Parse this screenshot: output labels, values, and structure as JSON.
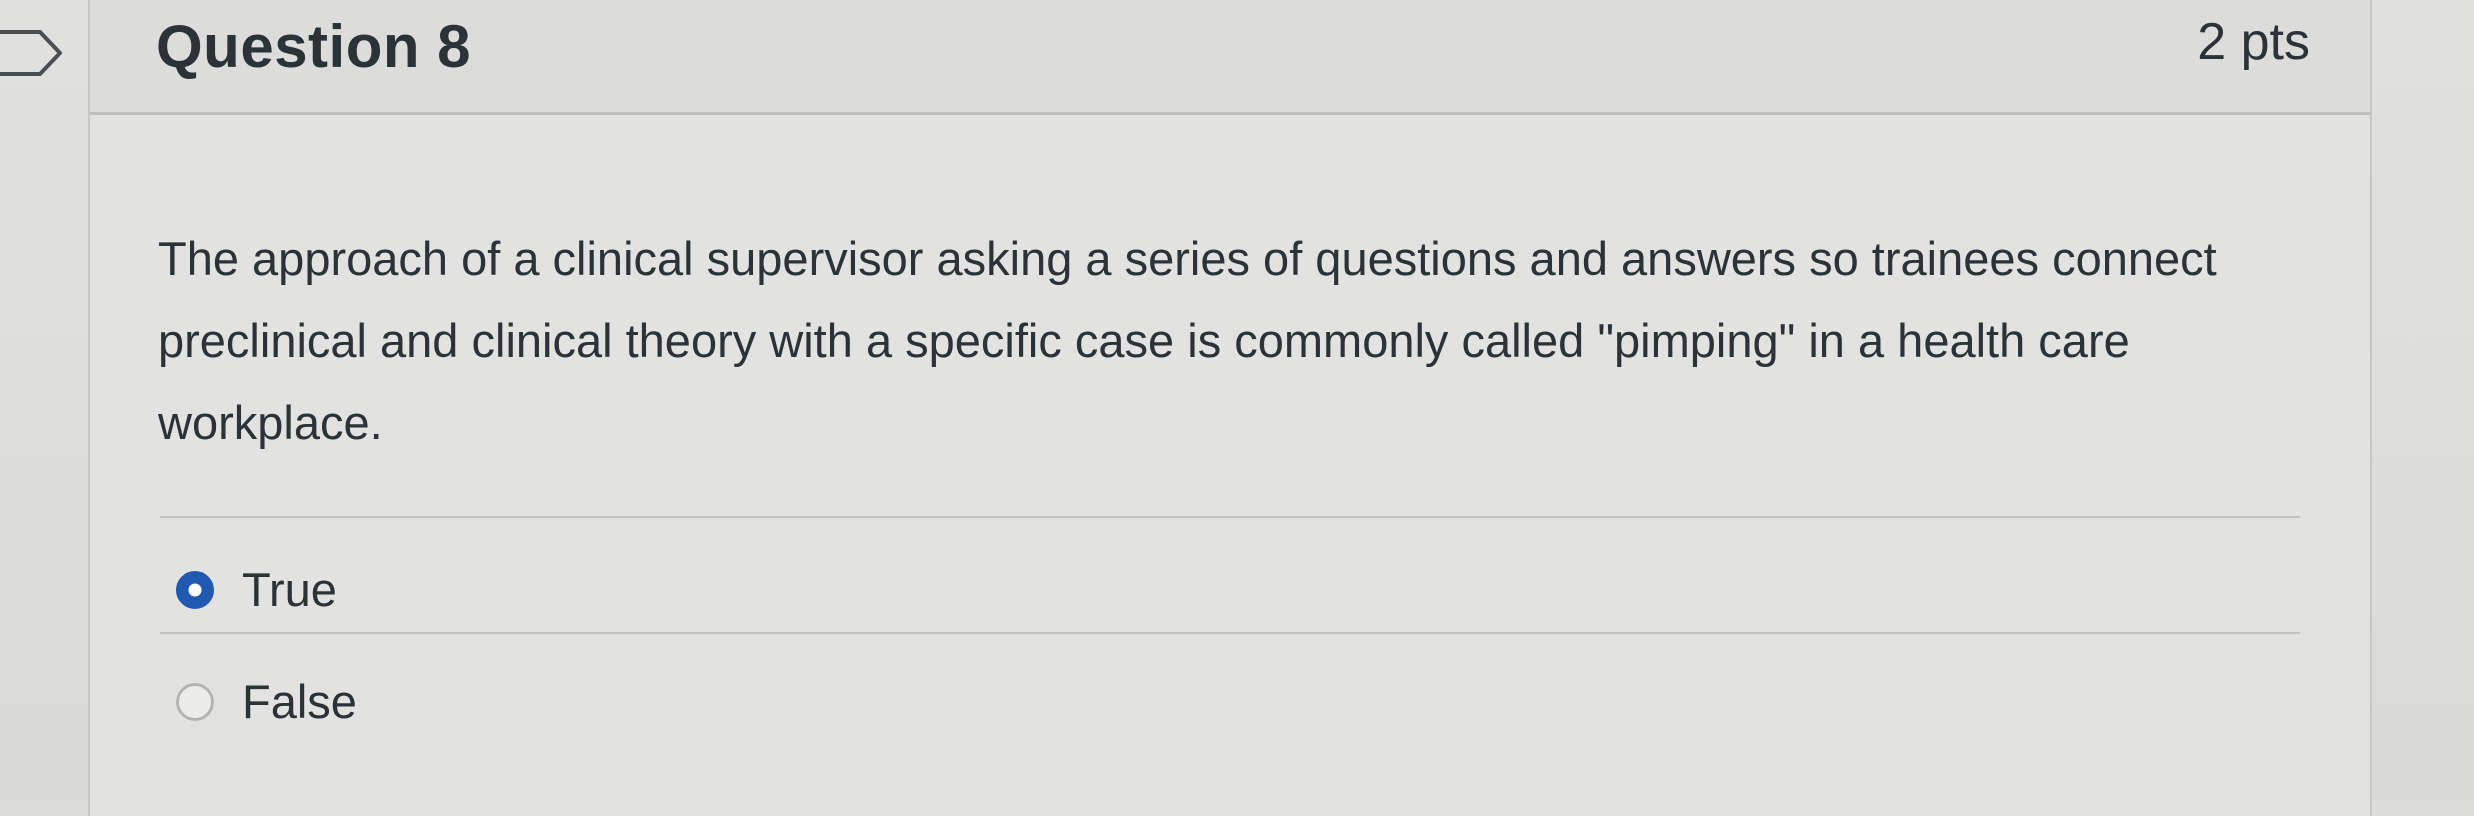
{
  "question": {
    "title": "Question 8",
    "points": "2 pts",
    "text": "The approach of a clinical supervisor asking a series of questions and answers so trainees connect preclinical and clinical theory with a specific case is commonly called \"pimping\" in a health care workplace.",
    "answers": [
      {
        "label": "True",
        "selected": true
      },
      {
        "label": "False",
        "selected": false
      }
    ]
  },
  "icons": {
    "flag": "flag-question-icon"
  },
  "colors": {
    "selected_radio": "#1f5ab0",
    "text": "#2b3338",
    "background": "#dcdcda"
  }
}
